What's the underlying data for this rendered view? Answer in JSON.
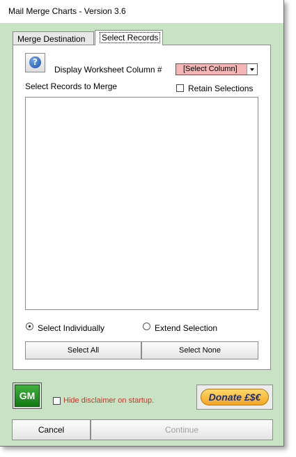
{
  "window": {
    "title": "Mail Merge Charts - Version 3.6"
  },
  "tabs": [
    {
      "label": "Merge Destination"
    },
    {
      "label": "Select Records"
    }
  ],
  "panel": {
    "display_column_label": "Display Worksheet Column #",
    "column_select": {
      "value": "[Select Column]"
    },
    "select_records_label": "Select Records to Merge",
    "retain_selections_label": "Retain Selections",
    "records": [],
    "radio_select_individually": "Select Individually",
    "radio_extend_selection": "Extend Selection",
    "select_all_label": "Select All",
    "select_none_label": "Select None"
  },
  "footer": {
    "gm_label": "GM",
    "hide_disclaimer_label": "Hide disclaimer on startup.",
    "donate_label": "Donate £$€",
    "cancel_label": "Cancel",
    "continue_label": "Continue"
  },
  "colors": {
    "window_bg": "#c8e2c4",
    "column_select_bg": "#f4b6b6",
    "disclaimer_text": "#c0392b",
    "donate_bg": "#f5a623"
  }
}
